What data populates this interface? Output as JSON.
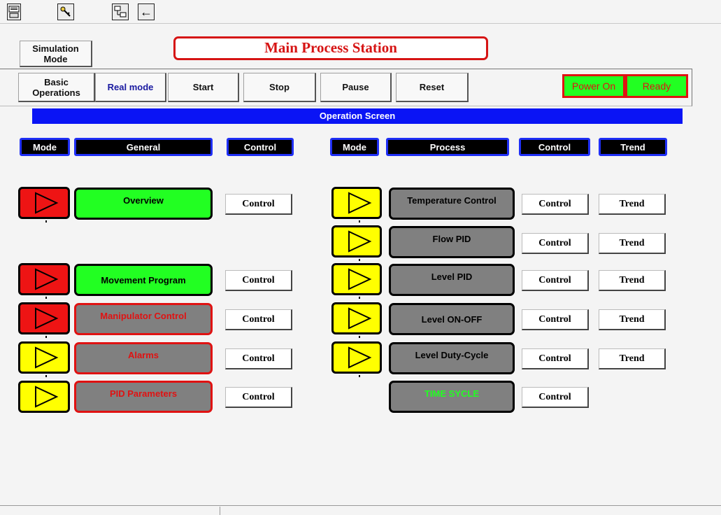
{
  "toolbar": {
    "icons": [
      "keyboard-icon",
      "key-icon",
      "network-icon",
      "arrow-left-icon"
    ],
    "arrow_glyph": "←"
  },
  "nav": {
    "simulation_mode": "Simulation\nMode",
    "basic_operations": "Basic\nOperations"
  },
  "title": "Main Process Station",
  "actions": {
    "real_mode": "Real mode",
    "start": "Start",
    "stop": "Stop",
    "pause": "Pause",
    "reset": "Reset"
  },
  "status": {
    "power": "Power On",
    "ready": "Ready"
  },
  "band": "Operation Screen",
  "headers": {
    "left": {
      "mode": "Mode",
      "general": "General",
      "control": "Control"
    },
    "right": {
      "mode": "Mode",
      "process": "Process",
      "control": "Control",
      "trend": "Trend"
    }
  },
  "general_items": [
    {
      "label": "Overview",
      "mode_color": "red",
      "style": "green",
      "control": "Control"
    },
    {
      "label": "Movement Program",
      "mode_color": "red",
      "style": "green",
      "control": "Control"
    },
    {
      "label": "Manipulator Control",
      "mode_color": "red",
      "style": "grayred",
      "control": "Control"
    },
    {
      "label": "Alarms",
      "mode_color": "yellow",
      "style": "grayred",
      "control": "Control"
    },
    {
      "label": "PID Parameters",
      "mode_color": "yellow",
      "style": "grayred",
      "control": "Control"
    }
  ],
  "process_items": [
    {
      "label": "Temperature Control",
      "control": "Control",
      "trend": "Trend"
    },
    {
      "label": "Flow PID",
      "control": "Control",
      "trend": "Trend"
    },
    {
      "label": "Level PID",
      "control": "Control",
      "trend": "Trend"
    },
    {
      "label": "Level ON-OFF",
      "control": "Control",
      "trend": "Trend"
    },
    {
      "label": "Level Duty-Cycle",
      "control": "Control",
      "trend": "Trend"
    },
    {
      "label": "TIME SYCLE",
      "control": "Control"
    }
  ],
  "colors": {
    "red": "#ee1414",
    "yellow": "#ffff00",
    "green": "#22ff22",
    "gray": "#808080",
    "blue": "#0a14f5"
  }
}
